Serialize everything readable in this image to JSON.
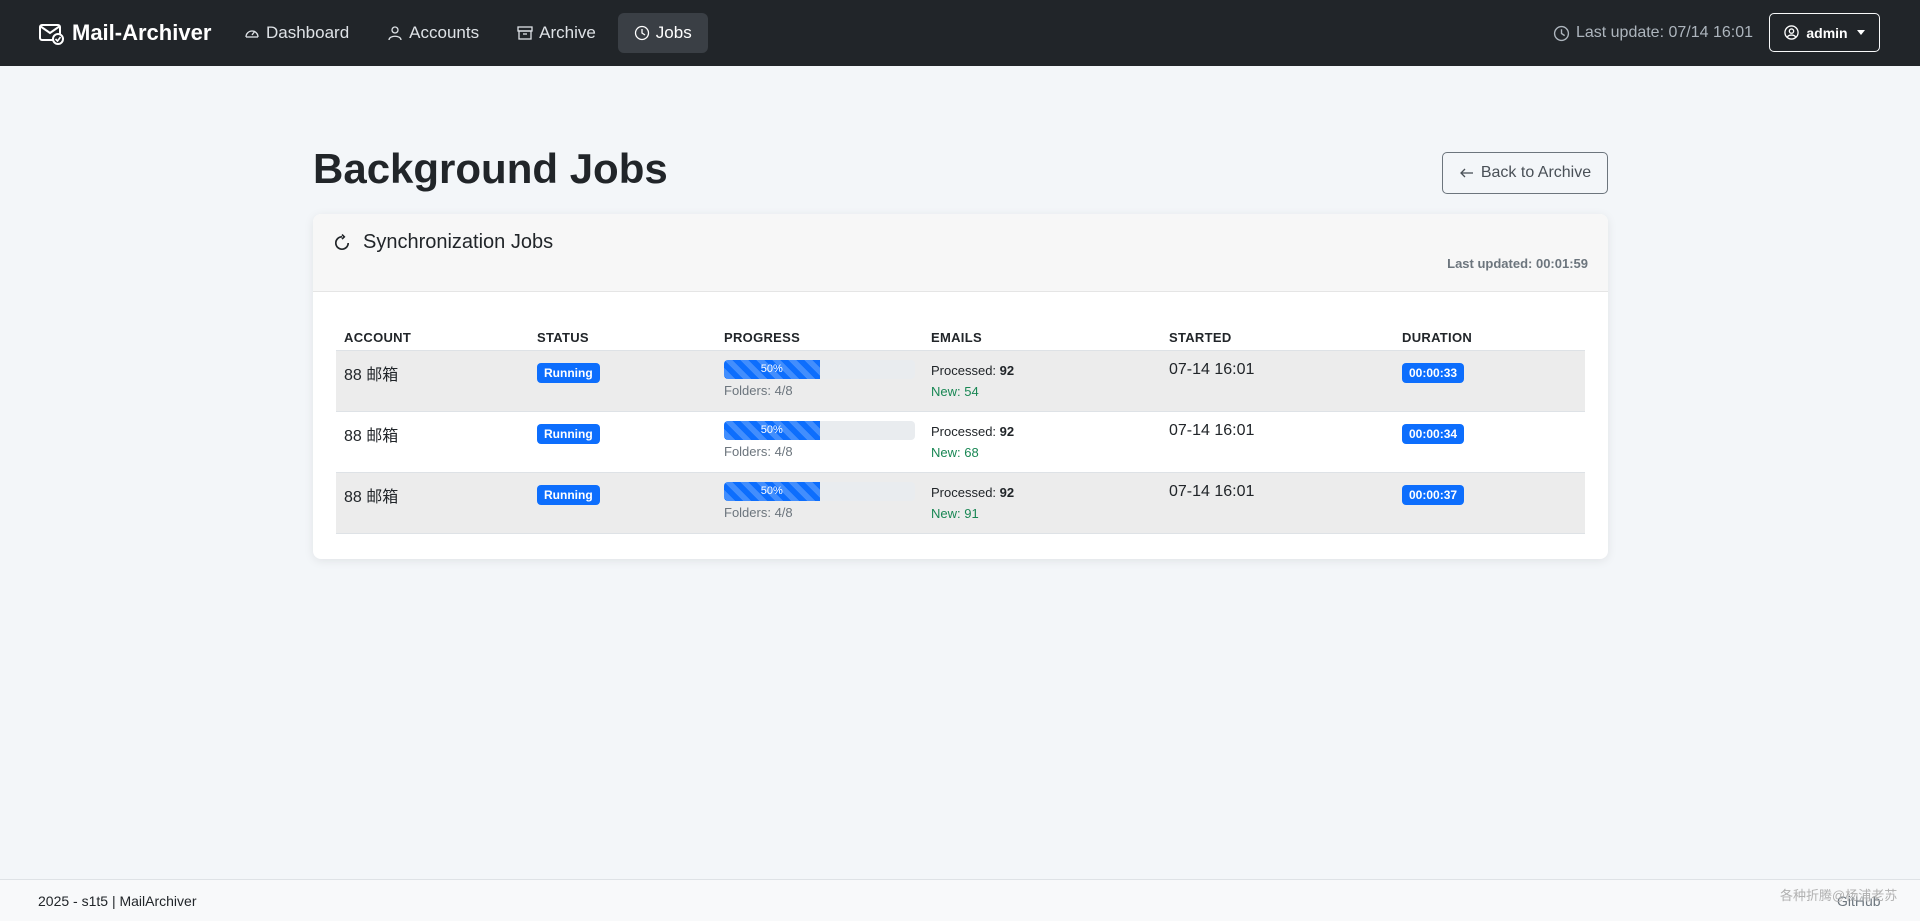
{
  "nav": {
    "brand": "Mail-Archiver",
    "links": [
      {
        "label": "Dashboard"
      },
      {
        "label": "Accounts"
      },
      {
        "label": "Archive"
      },
      {
        "label": "Jobs"
      }
    ],
    "last_update": "Last update: 07/14 16:01",
    "user": "admin"
  },
  "page": {
    "title": "Background Jobs",
    "back_label": "Back to Archive"
  },
  "card": {
    "title": "Synchronization Jobs",
    "last_updated": "Last updated: 00:01:59",
    "columns": [
      "ACCOUNT",
      "STATUS",
      "PROGRESS",
      "EMAILS",
      "STARTED",
      "DURATION"
    ],
    "rows": [
      {
        "account": "88 邮箱",
        "status": "Running",
        "progress": 50,
        "progress_label": "50%",
        "folders": "Folders: 4/8",
        "processed_label": "Processed:",
        "processed": "92",
        "new": "New: 54",
        "started": "07-14 16:01",
        "duration": "00:00:33"
      },
      {
        "account": "88 邮箱",
        "status": "Running",
        "progress": 50,
        "progress_label": "50%",
        "folders": "Folders: 4/8",
        "processed_label": "Processed:",
        "processed": "92",
        "new": "New: 68",
        "started": "07-14 16:01",
        "duration": "00:00:34"
      },
      {
        "account": "88 邮箱",
        "status": "Running",
        "progress": 50,
        "progress_label": "50%",
        "folders": "Folders: 4/8",
        "processed_label": "Processed:",
        "processed": "92",
        "new": "New: 91",
        "started": "07-14 16:01",
        "duration": "00:00:37"
      }
    ]
  },
  "footer": {
    "text": "2025 - s1t5 | MailArchiver",
    "link": "GitHub",
    "watermark": "各种折腾@杨浦老苏"
  },
  "colors": {
    "navbar": "#212529",
    "accent": "#0d6efd",
    "success": "#198754"
  }
}
